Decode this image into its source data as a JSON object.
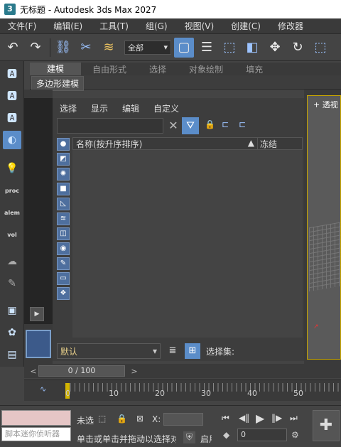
{
  "window": {
    "title": "无标题 - Autodesk 3ds Max 2027",
    "app_icon": "3"
  },
  "menubar": [
    "文件(F)",
    "编辑(E)",
    "工具(T)",
    "组(G)",
    "视图(V)",
    "创建(C)",
    "修改器"
  ],
  "toolbar": {
    "selection_filter": "全部",
    "selection_filter_arrow": "▾"
  },
  "ribbon": {
    "tabs": [
      "建模",
      "自由形式",
      "选择",
      "对象绘制",
      "填充"
    ],
    "active_tab": 0,
    "sub_button": "多边形建模"
  },
  "leftstrip": {
    "proc": "proc",
    "alem": "alem",
    "vol": "vol"
  },
  "scene_explorer": {
    "menu": [
      "选择",
      "显示",
      "编辑",
      "自定义"
    ],
    "search_placeholder": "",
    "column_name": "名称(按升序排序)",
    "sort_indicator": "▲",
    "column_freeze": "冻结",
    "layer": "默认",
    "selection_set_label": "选择集:"
  },
  "viewport": {
    "label": "透视"
  },
  "timeline": {
    "frame_display": "0 / 100",
    "prev": "<",
    "next": ">"
  },
  "trackbar": {
    "ticks": [
      "0",
      "10",
      "20",
      "30",
      "40",
      "50"
    ]
  },
  "status": {
    "listener_hint": "脚本迷你侦听器",
    "selection_status": "未选定任何对象",
    "prompt": "单击或单击并拖动以选择对象",
    "enable_label": "启用",
    "x_label": "X:",
    "frame_value": "0"
  },
  "colors": {
    "accent": "#5b8dc9",
    "key": "#d2b400",
    "viewport_border": "#c8a600"
  }
}
